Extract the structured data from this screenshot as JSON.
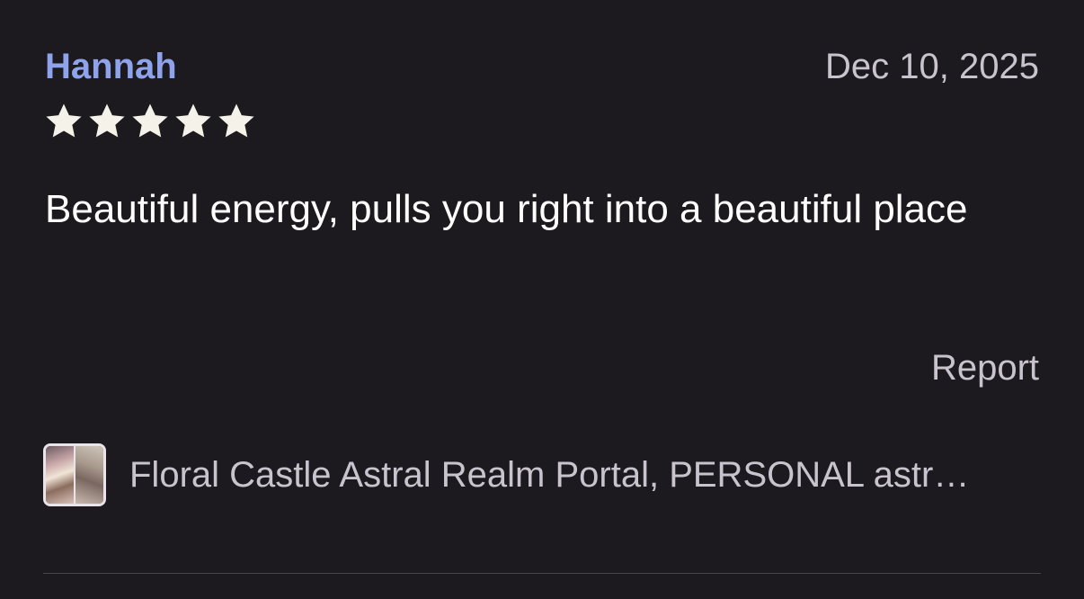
{
  "review": {
    "reviewer_name": "Hannah",
    "date": "Dec 10, 2025",
    "rating": 5,
    "rating_max": 5,
    "text": "Beautiful energy, pulls you right into a beautiful place",
    "report_label": "Report",
    "product": {
      "title": "Floral Castle Astral Realm Portal, PERSONAL astr…",
      "thumbnail_icon": "product-thumbnail"
    }
  },
  "colors": {
    "background": "#1c1a1e",
    "name_accent": "#8fa3ec",
    "muted_text": "#c9c3cd",
    "star": "#f5f2ea",
    "divider": "#4a454c"
  }
}
